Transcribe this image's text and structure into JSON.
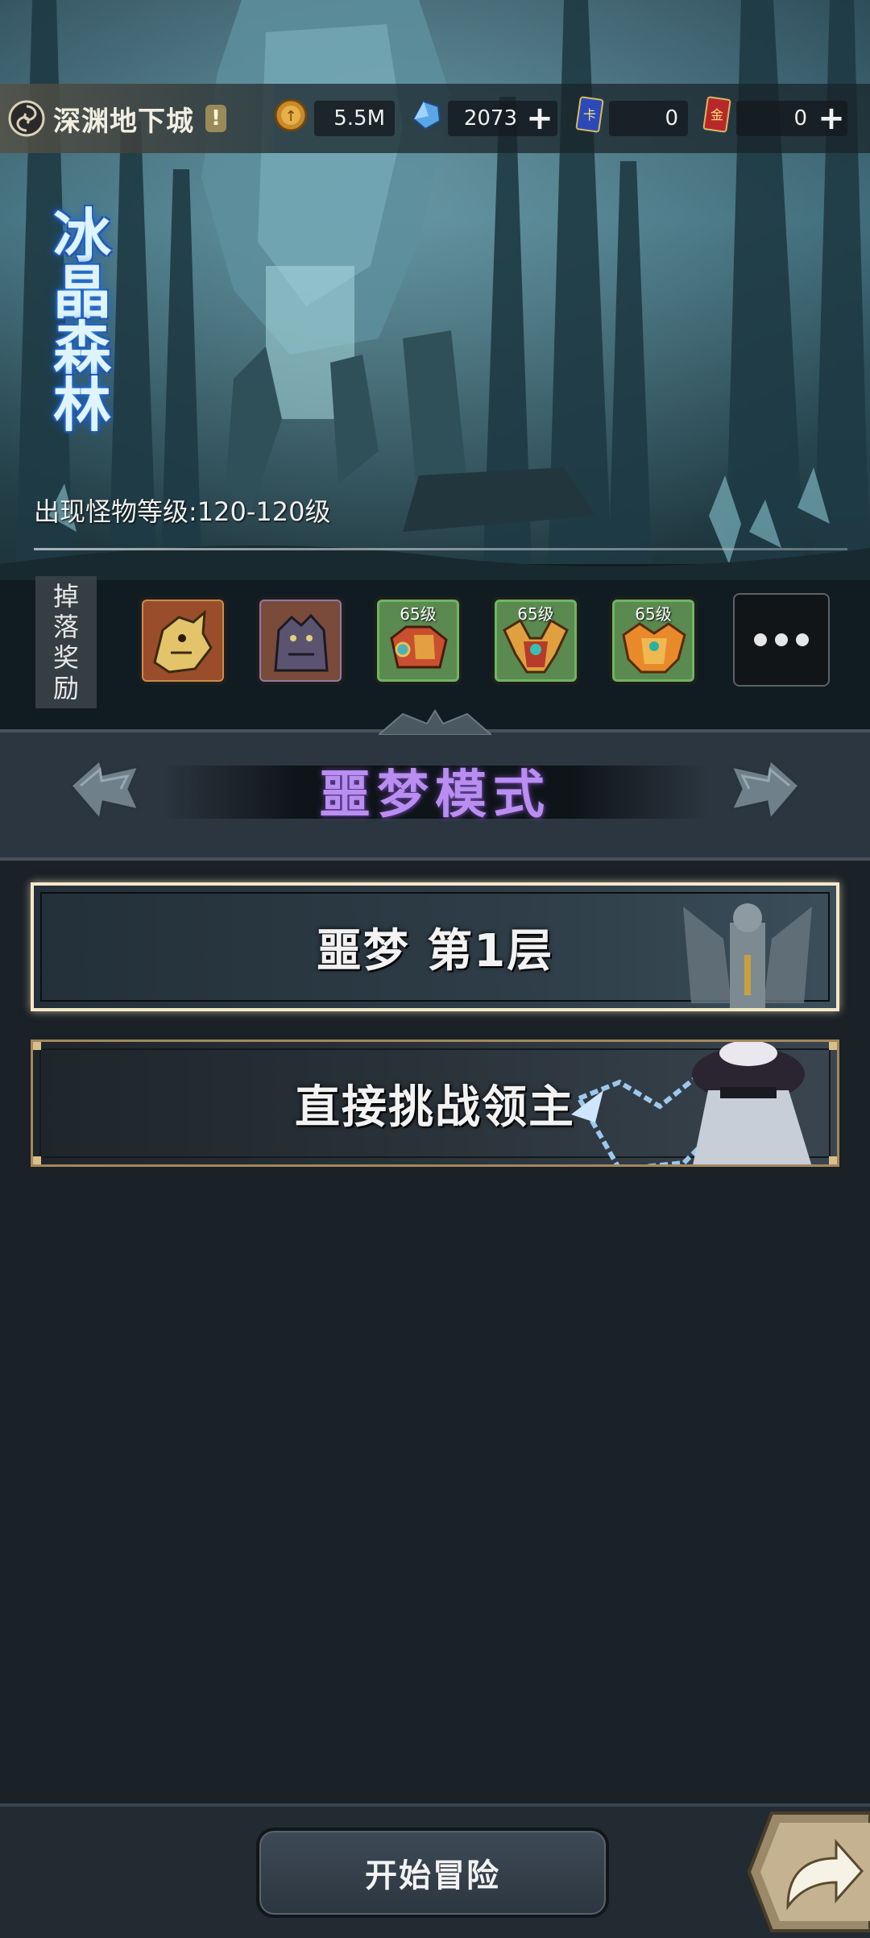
{
  "header": {
    "dungeon_name": "深渊地下城",
    "info_badge": "!",
    "resources": [
      {
        "icon": "gold-coin-icon",
        "value": "5.5M",
        "has_plus": false
      },
      {
        "icon": "blue-crystal-icon",
        "value": "2073",
        "has_plus": true
      },
      {
        "icon": "blue-ticket-card-icon",
        "value": "0",
        "has_plus": false
      },
      {
        "icon": "red-gold-card-icon",
        "value": "0",
        "has_plus": true
      }
    ]
  },
  "zone": {
    "title_chars": [
      "冰",
      "晶",
      "森",
      "林"
    ],
    "monster_level": "出现怪物等级:120-120级"
  },
  "drops": {
    "label_chars": [
      "掉",
      "落",
      "奖",
      "励"
    ],
    "items": [
      {
        "icon": "golden-dragon-monster-icon",
        "level": ""
      },
      {
        "icon": "dark-beast-monster-icon",
        "level": ""
      },
      {
        "icon": "red-armor-icon",
        "level": "65级"
      },
      {
        "icon": "winged-helmet-icon",
        "level": "65级"
      },
      {
        "icon": "phoenix-armor-icon",
        "level": "65级"
      }
    ],
    "more_label": "more-icon"
  },
  "mode": {
    "title": "噩梦模式"
  },
  "levels": [
    {
      "label": "噩梦 第1层",
      "selected": true
    },
    {
      "label": "直接挑战领主",
      "selected": false
    }
  ],
  "footer": {
    "start_label": "开始冒险"
  },
  "colors": {
    "mode_title": "#b98ef0",
    "selected_border": "#f5e8c8",
    "background": "#1a2127"
  }
}
